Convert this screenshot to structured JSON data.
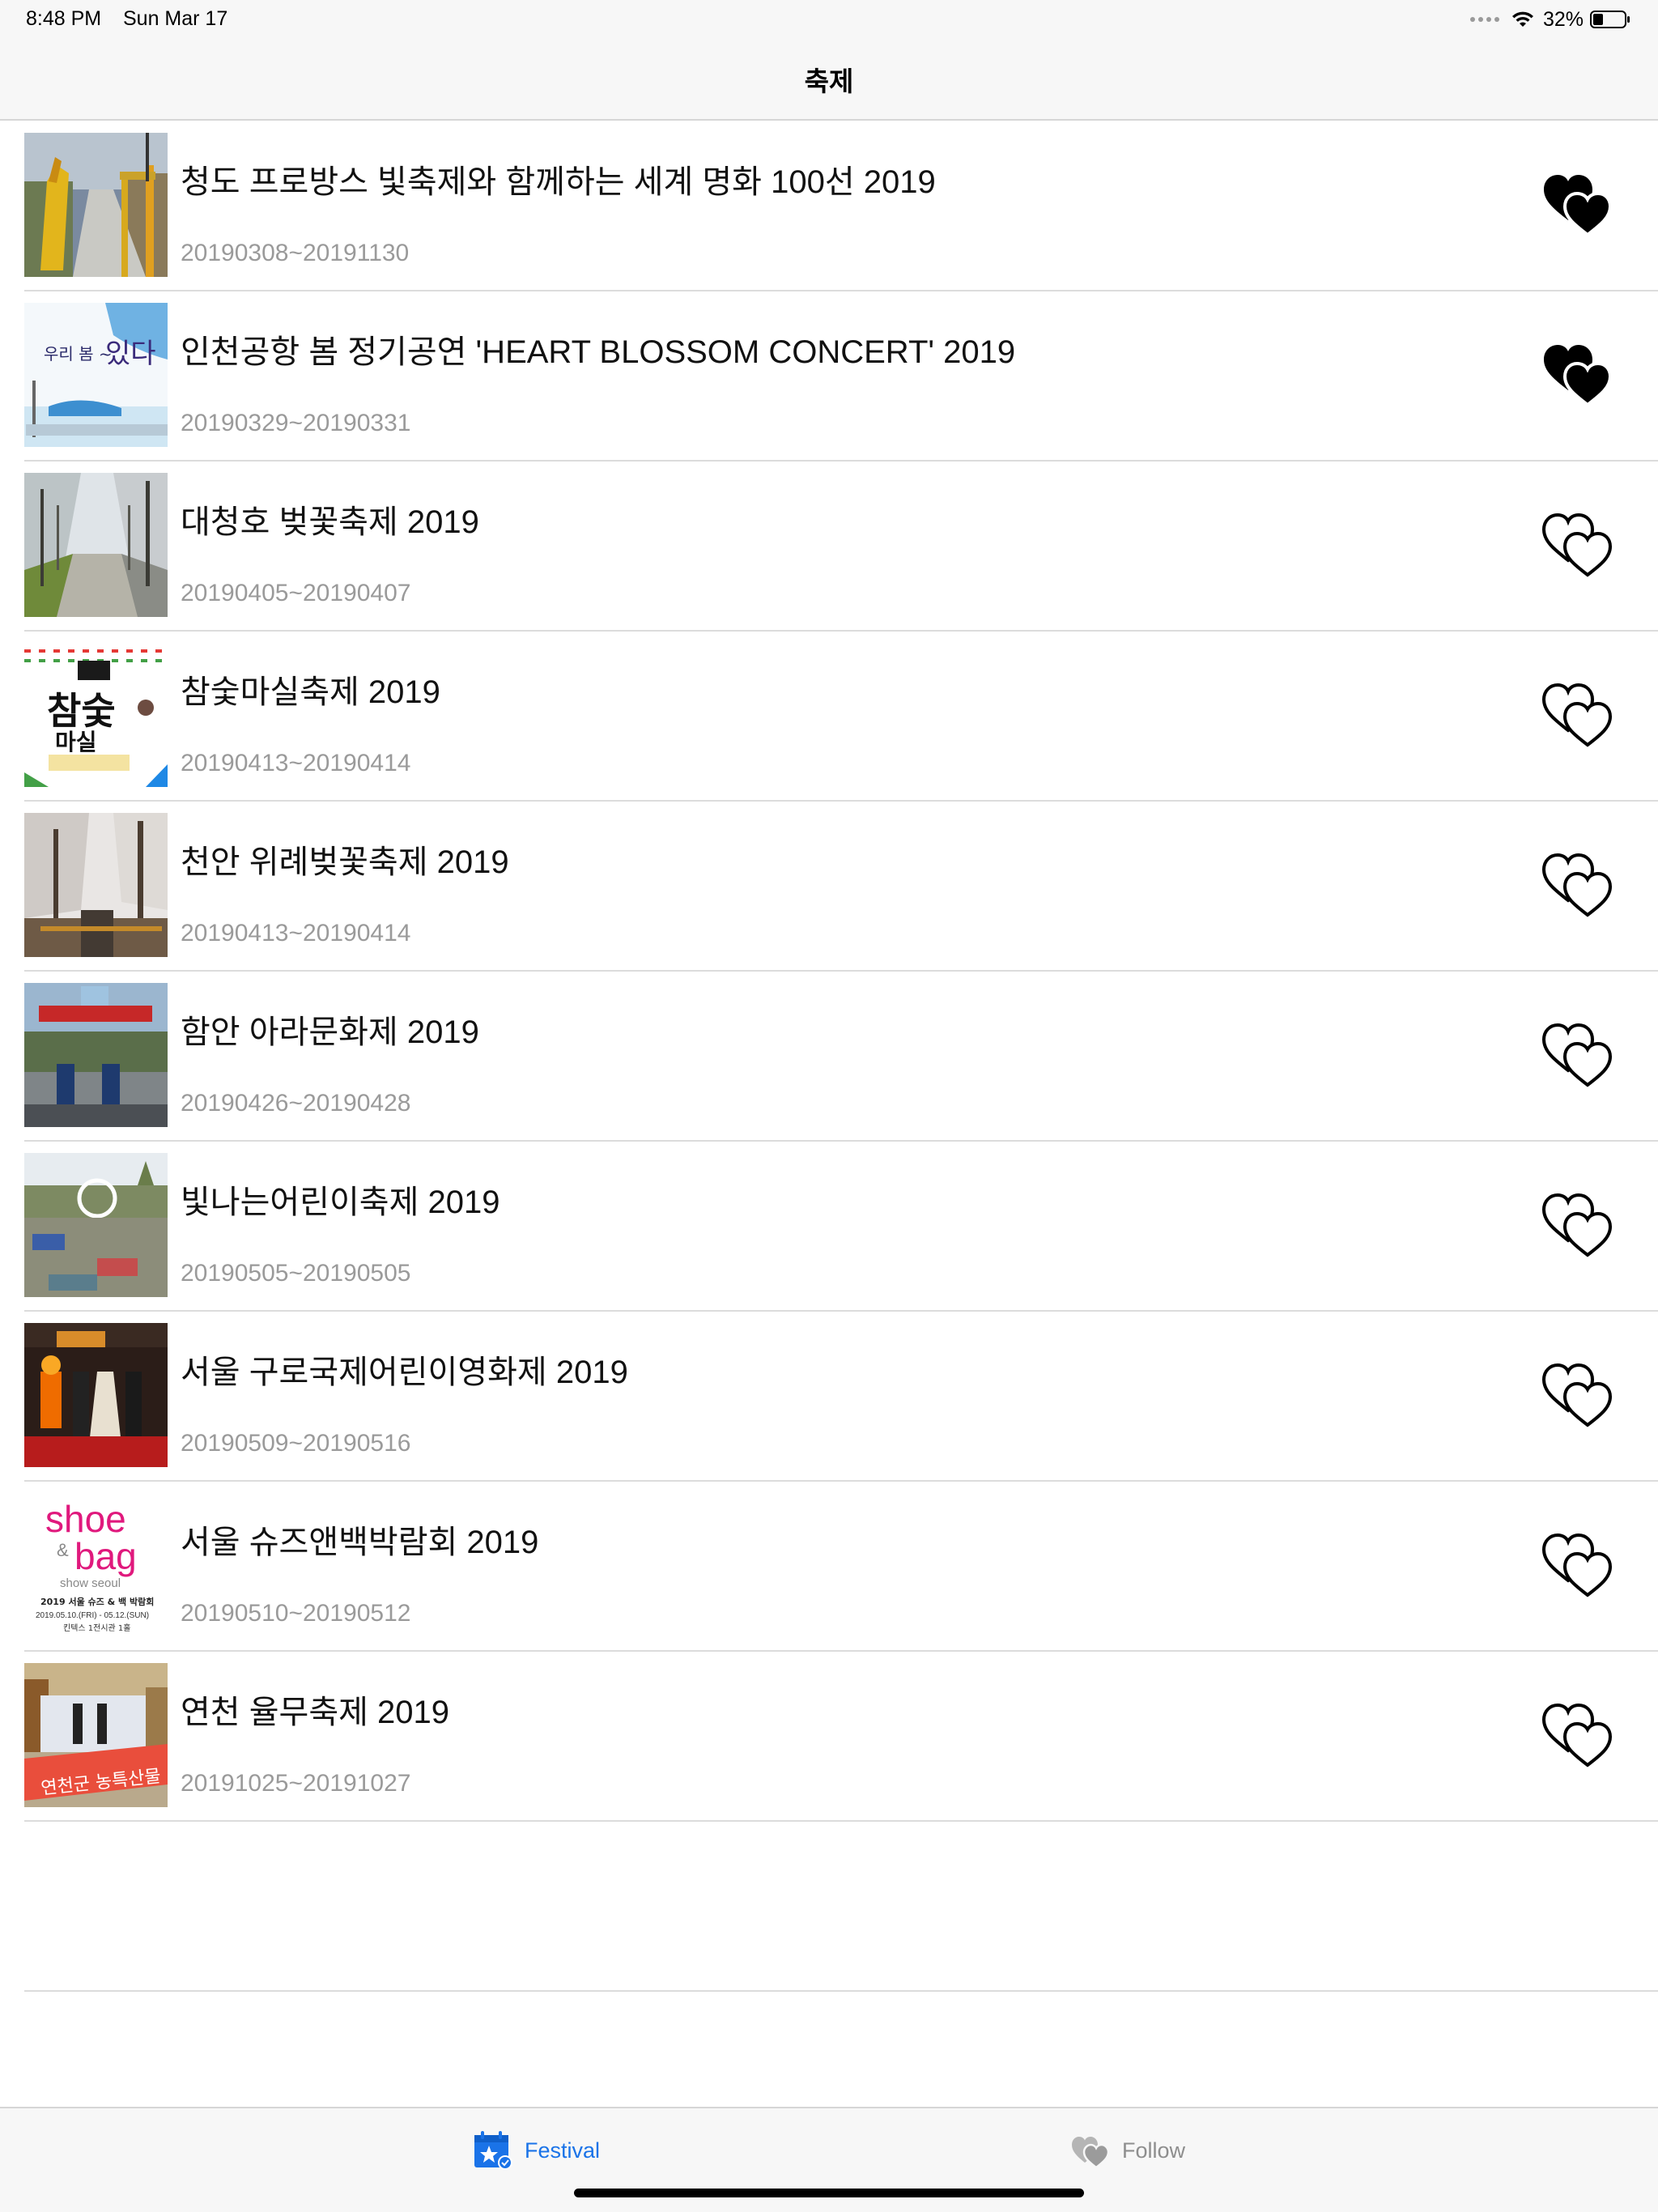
{
  "status_bar": {
    "time": "8:48 PM",
    "date": "Sun Mar 17",
    "battery_percent": "32%",
    "battery_level": 0.32
  },
  "nav": {
    "title": "축제"
  },
  "festivals": [
    {
      "title": "청도 프로방스 빛축제와 함께하는 세계 명화 100선 2019",
      "dates": "20190308~20191130",
      "followed": true,
      "thumb": "lights-garden"
    },
    {
      "title": "인천공항 봄 정기공연 'HEART BLOSSOM CONCERT' 2019",
      "dates": "20190329~20190331",
      "followed": true,
      "thumb": "concert-poster"
    },
    {
      "title": "대청호 벚꽃축제 2019",
      "dates": "20190405~20190407",
      "followed": false,
      "thumb": "cherry-road"
    },
    {
      "title": "참숯마실축제 2019",
      "dates": "20190413~20190414",
      "followed": false,
      "thumb": "charcoal-poster"
    },
    {
      "title": "천안 위례벚꽃축제 2019",
      "dates": "20190413~20190414",
      "followed": false,
      "thumb": "cherry-crowd"
    },
    {
      "title": "함안 아라문화제 2019",
      "dates": "20190426~20190428",
      "followed": false,
      "thumb": "parade"
    },
    {
      "title": "빛나는어린이축제 2019",
      "dates": "20190505~20190505",
      "followed": false,
      "thumb": "picnic-crowd"
    },
    {
      "title": "서울 구로국제어린이영화제 2019",
      "dates": "20190509~20190516",
      "followed": false,
      "thumb": "stage-performers"
    },
    {
      "title": "서울 슈즈앤백박람회 2019",
      "dates": "20190510~20190512",
      "followed": false,
      "thumb": "shoe-bag-logo",
      "thumb_text": {
        "line1": "shoe",
        "amp": "&",
        "line2": "bag",
        "line3": "show seoul",
        "line4": "2019 서울 슈즈 & 백 박람회",
        "line5": "2019.05.10.(FRI) - 05.12.(SUN)",
        "line6": "킨텍스 1전시관 1홀"
      }
    },
    {
      "title": "연천 율무축제 2019",
      "dates": "20191025~20191027",
      "followed": false,
      "thumb": "banner-stage"
    }
  ],
  "tabs": [
    {
      "label": "Festival",
      "icon": "calendar-star-icon",
      "selected": true
    },
    {
      "label": "Follow",
      "icon": "hearts-icon",
      "selected": false
    }
  ],
  "colors": {
    "accent": "#1a73e8",
    "inactive": "#8e8e8e",
    "date_gray": "#9a9a9a"
  }
}
